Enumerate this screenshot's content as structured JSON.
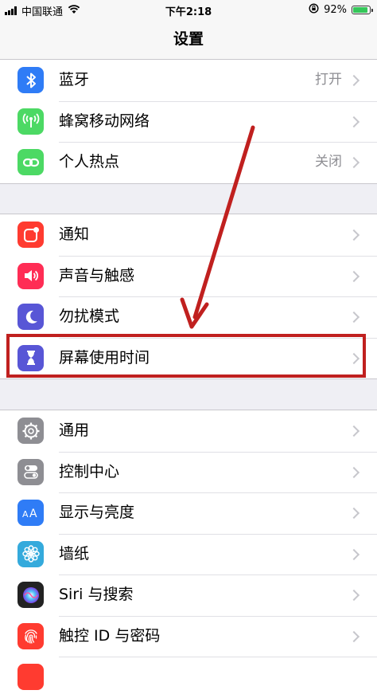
{
  "status_bar": {
    "carrier": "中国联通",
    "time": "下午2:18",
    "battery_percent": "92%",
    "battery_level": 0.92
  },
  "nav": {
    "title": "设置"
  },
  "groups": [
    {
      "rows": [
        {
          "label": "蓝牙",
          "value": "打开",
          "icon": "bluetooth-icon",
          "color": "#2f7cf6"
        },
        {
          "label": "蜂窝移动网络",
          "value": "",
          "icon": "cellular-icon",
          "color": "#4cd964"
        },
        {
          "label": "个人热点",
          "value": "关闭",
          "icon": "hotspot-icon",
          "color": "#4cd964"
        }
      ]
    },
    {
      "rows": [
        {
          "label": "通知",
          "value": "",
          "icon": "notifications-icon",
          "color": "#ff3b30"
        },
        {
          "label": "声音与触感",
          "value": "",
          "icon": "sound-icon",
          "color": "#ff2d55"
        },
        {
          "label": "勿扰模式",
          "value": "",
          "icon": "moon-icon",
          "color": "#5856d6"
        },
        {
          "label": "屏幕使用时间",
          "value": "",
          "icon": "hourglass-icon",
          "color": "#5856d6"
        }
      ]
    },
    {
      "rows": [
        {
          "label": "通用",
          "value": "",
          "icon": "gear-icon",
          "color": "#8e8e93"
        },
        {
          "label": "控制中心",
          "value": "",
          "icon": "control-center-icon",
          "color": "#8e8e93"
        },
        {
          "label": "显示与亮度",
          "value": "",
          "icon": "display-icon",
          "color": "#2f7cf6"
        },
        {
          "label": "墙纸",
          "value": "",
          "icon": "wallpaper-icon",
          "color": "#34aadc"
        },
        {
          "label": "Siri 与搜索",
          "value": "",
          "icon": "siri-icon",
          "color": "#222222"
        },
        {
          "label": "触控 ID 与密码",
          "value": "",
          "icon": "fingerprint-icon",
          "color": "#ff3b30"
        }
      ]
    }
  ],
  "annotation_color": "#c0201f"
}
